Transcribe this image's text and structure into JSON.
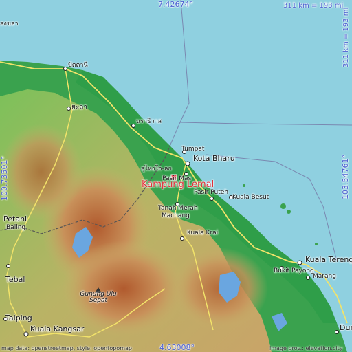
{
  "coords": {
    "top": "7.42674°",
    "bottom": "4.63008°",
    "left": "100.73501°",
    "right": "103.54761°",
    "scale_top": "311 km = 193 mi",
    "scale_right": "311 km = 193 mi"
  },
  "featured_place": "Kampung Lemal",
  "places": {
    "pattani": "ปัตตานี",
    "yala": "ยะลา",
    "narathiwat": "นราธิวาส",
    "songkhla_partial": "สงขลา",
    "su_ngai_kolok": "สุไหงโก-ลก",
    "tumpat": "Tumpat",
    "kota_bharu": "Kota Bharu",
    "pasir_mas": "Pasir Mas",
    "pasir_puteh": "Pasir Puteh",
    "kuala_besut": "Kuala Besut",
    "tanah_merah": "Tanah Merah",
    "machang": "Machang",
    "kuala_krai": "Kuala Krai",
    "kuala_terengganu": "Kuala Tereng",
    "bukit_payong": "Bukit Payong",
    "marang": "Marang",
    "dungun": "Dun",
    "petani": "Petani",
    "baling": "Baling",
    "tebal": "Tebal",
    "taiping": "Taiping",
    "kuala_kangsar": "Kuala Kangsar",
    "gunung_ulu_sepat": "Gunung Ulu Sepat"
  },
  "attribution": {
    "left": "map data: openstreetmap, style: opentopomap",
    "right": "image prov.: elevation.city"
  },
  "colors": {
    "sea": "#8fd0e0",
    "lowland": "#2f9e49",
    "highland": "#c8b06a",
    "featured": "#e0303a",
    "coord_text": "#4a5fd1"
  }
}
